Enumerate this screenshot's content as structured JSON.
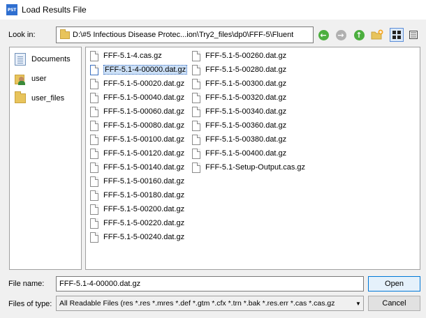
{
  "window": {
    "icon_text": "PST",
    "title": "Load Results File"
  },
  "toolbar": {
    "look_in_label": "Look in:",
    "path": "D:\\#5 Infectious Disease Protec...ion\\Try2_files\\dp0\\FFF-5\\Fluent",
    "icons": [
      "back-icon",
      "forward-icon",
      "up-icon",
      "new-folder-icon",
      "list-view-icon",
      "detail-view-icon"
    ],
    "accent_green": "#4caf3f",
    "disabled_gray": "#b0b0b0"
  },
  "places": [
    {
      "label": "Documents",
      "icon": "documents-icon"
    },
    {
      "label": "user",
      "icon": "user-folder-icon"
    },
    {
      "label": "user_files",
      "icon": "folder-icon"
    }
  ],
  "files": {
    "column1": [
      "FFF-5.1-4.cas.gz",
      "FFF-5.1-4-00000.dat.gz",
      "FFF-5.1-5-00020.dat.gz",
      "FFF-5.1-5-00040.dat.gz",
      "FFF-5.1-5-00060.dat.gz",
      "FFF-5.1-5-00080.dat.gz",
      "FFF-5.1-5-00100.dat.gz",
      "FFF-5.1-5-00120.dat.gz",
      "FFF-5.1-5-00140.dat.gz",
      "FFF-5.1-5-00160.dat.gz",
      "FFF-5.1-5-00180.dat.gz",
      "FFF-5.1-5-00200.dat.gz",
      "FFF-5.1-5-00220.dat.gz",
      "FFF-5.1-5-00240.dat.gz"
    ],
    "column2": [
      "FFF-5.1-5-00260.dat.gz",
      "FFF-5.1-5-00280.dat.gz",
      "FFF-5.1-5-00300.dat.gz",
      "FFF-5.1-5-00320.dat.gz",
      "FFF-5.1-5-00340.dat.gz",
      "FFF-5.1-5-00360.dat.gz",
      "FFF-5.1-5-00380.dat.gz",
      "FFF-5.1-5-00400.dat.gz",
      "FFF-5.1-Setup-Output.cas.gz"
    ],
    "selected": "FFF-5.1-4-00000.dat.gz"
  },
  "form": {
    "file_name_label": "File name:",
    "file_name_value": "FFF-5.1-4-00000.dat.gz",
    "file_type_label": "Files of type:",
    "file_type_value": "All Readable Files (res *.res *.mres *.def *.gtm *.cfx *.trn *.bak *.res.err *.cas *.cas.gz",
    "open_label": "Open",
    "cancel_label": "Cancel"
  }
}
